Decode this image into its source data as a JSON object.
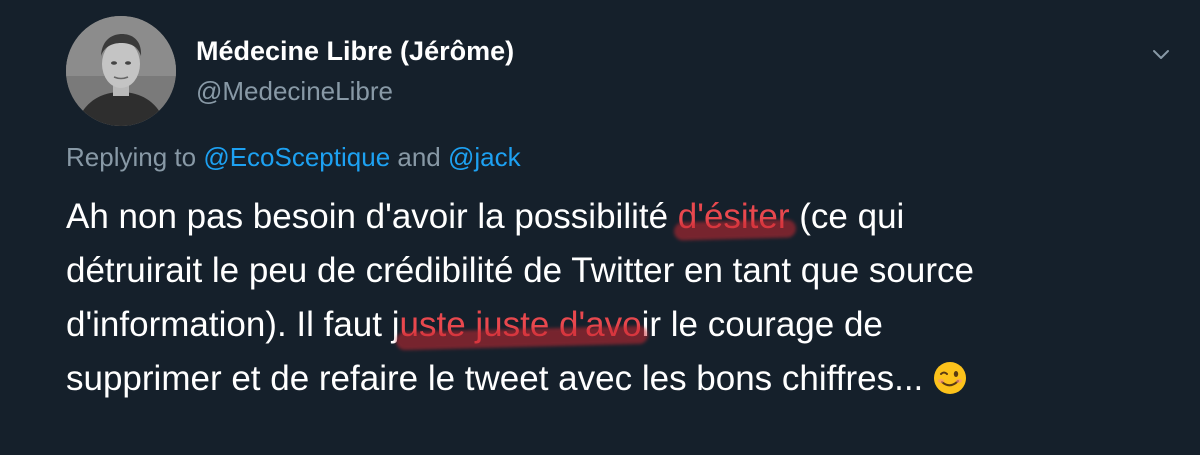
{
  "tweet": {
    "author_name": "Médecine Libre (Jérôme)",
    "author_handle": "@MedecineLibre",
    "replying_prefix": "Replying to ",
    "replying_mention_1": "@EcoSceptique",
    "replying_and": " and ",
    "replying_mention_2": "@jack",
    "lines": {
      "l1_a": "Ah non pas besoin d'avoir la possibilité ",
      "l1_hl": "d'ésiter",
      "l1_b": " (ce qui",
      "l2": "détruirait le peu de crédibilité de Twitter en tant que source",
      "l3_a": "d'information). Il faut j",
      "l3_hl": "uste juste d'avo",
      "l3_b": "ir le courage de",
      "l4": "supprimer et de refaire le tweet avec les bons chiffres..."
    },
    "emoji": "winking-face-emoji",
    "icons": {
      "caret": "chevron-down-icon"
    },
    "colors": {
      "background": "#15202b",
      "secondary_text": "#8899a6",
      "mention": "#1da1f2",
      "highlight": "#e8484e"
    }
  }
}
